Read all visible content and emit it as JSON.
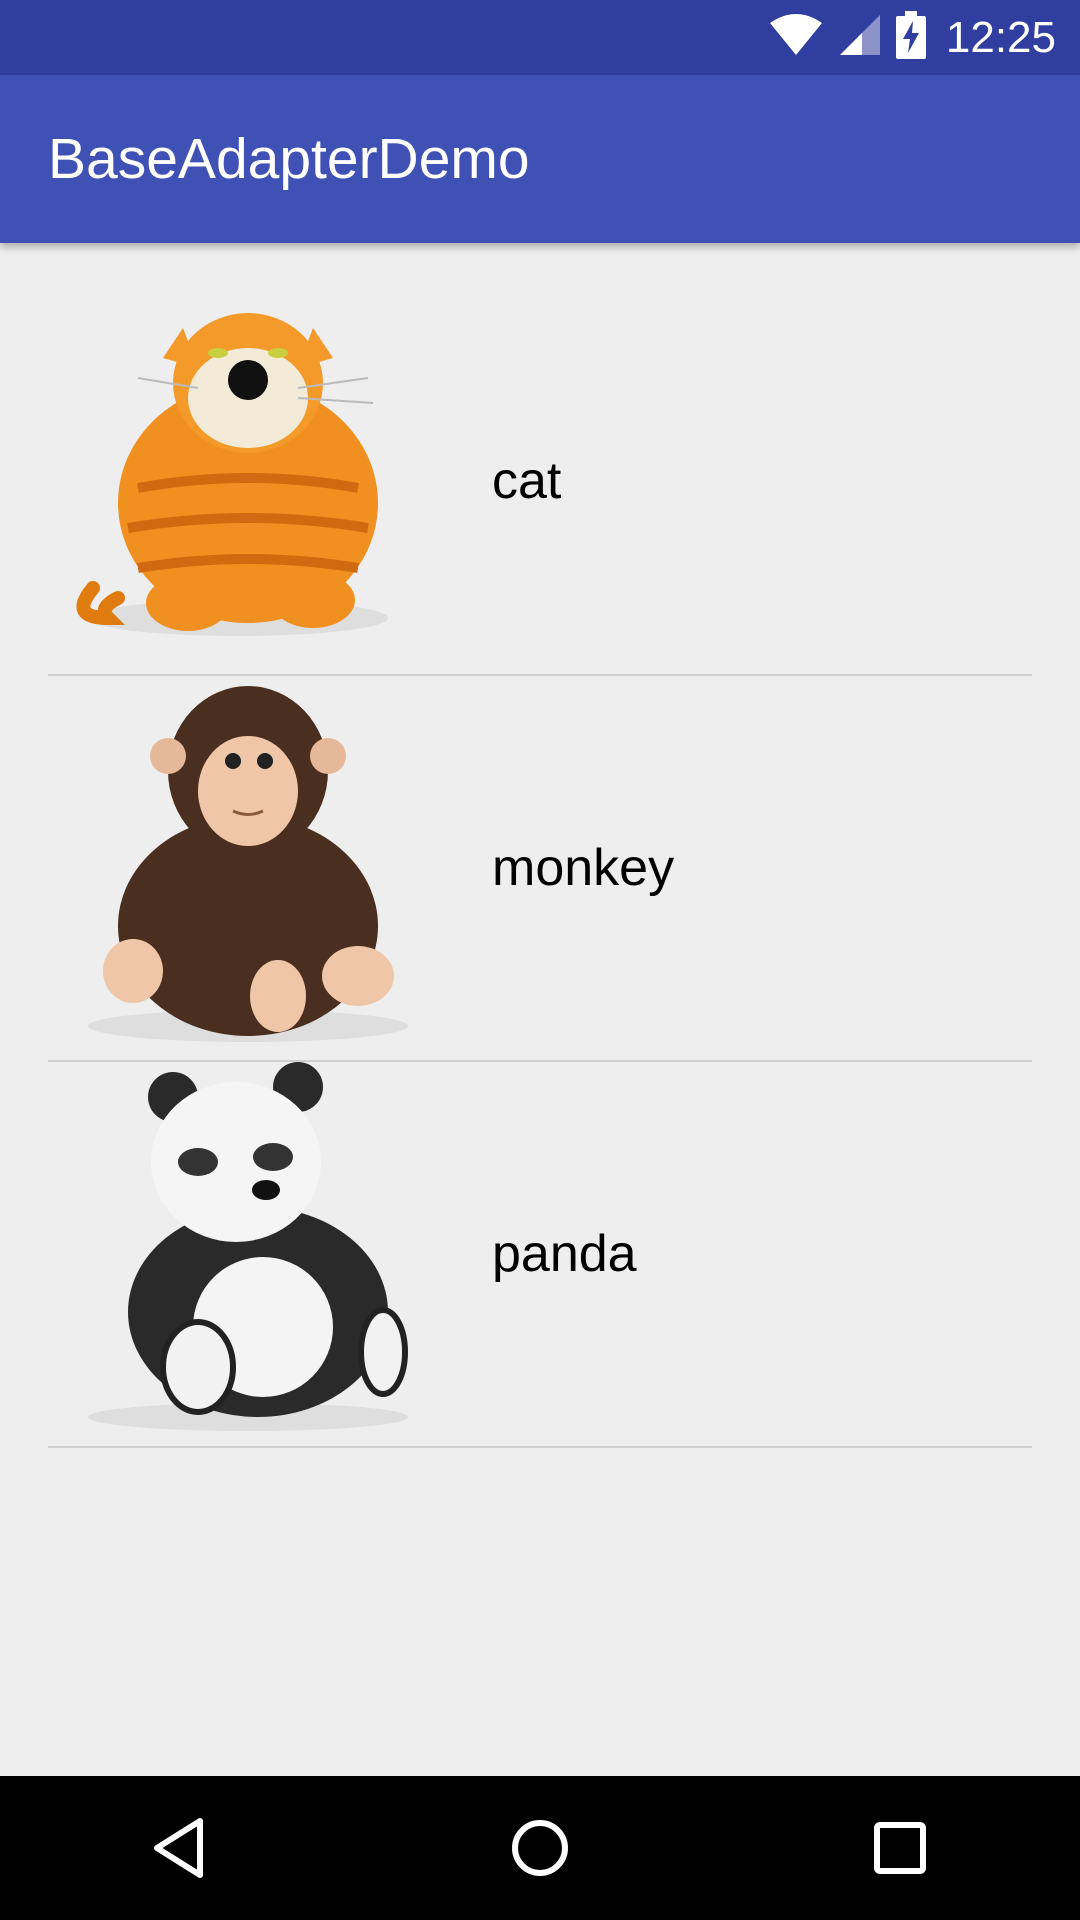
{
  "status_bar": {
    "time": "12:25",
    "icons": [
      "wifi-icon",
      "cell-signal-icon",
      "battery-charging-icon"
    ]
  },
  "app_bar": {
    "title": "BaseAdapterDemo",
    "color": "#3f51b5",
    "status_color": "#303f9f"
  },
  "list": {
    "items": [
      {
        "label": "cat",
        "image": "cat-plush-image"
      },
      {
        "label": "monkey",
        "image": "monkey-plush-image"
      },
      {
        "label": "panda",
        "image": "panda-plush-image"
      }
    ]
  },
  "nav_bar": {
    "buttons": [
      "back-icon",
      "home-icon",
      "recents-icon"
    ]
  }
}
